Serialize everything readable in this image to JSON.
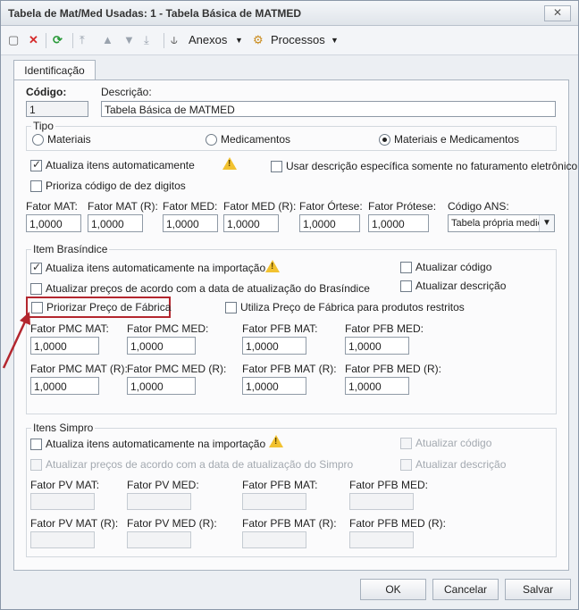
{
  "window": {
    "title": "Tabela de Mat/Med Usadas: 1 - Tabela Básica de MATMED",
    "close_label": "✕"
  },
  "toolbar": {
    "anexos": "Anexos",
    "processos": "Processos"
  },
  "tabs": {
    "identificacao": "Identificação"
  },
  "form": {
    "codigo_label": "Código:",
    "codigo_value": "1",
    "descricao_label": "Descrição:",
    "descricao_value": "Tabela Básica de MATMED",
    "tipo_label": "Tipo",
    "tipo_options": [
      "Materiais",
      "Medicamentos",
      "Materiais e Medicamentos"
    ],
    "tipo_selected": "Materiais e Medicamentos",
    "atualiza_itens": "Atualiza itens automaticamente",
    "usar_descricao": "Usar descrição específica somente no faturamento eletrônico",
    "prioriza_codigo": "Prioriza código de dez digitos",
    "fatores": [
      {
        "label": "Fator MAT:",
        "value": "1,0000"
      },
      {
        "label": "Fator MAT (R):",
        "value": "1,0000"
      },
      {
        "label": "Fator MED:",
        "value": "1,0000"
      },
      {
        "label": "Fator MED (R):",
        "value": "1,0000"
      },
      {
        "label": "Fator Órtese:",
        "value": "1,0000"
      },
      {
        "label": "Fator Prótese:",
        "value": "1,0000"
      }
    ],
    "codigo_ans_label": "Código ANS:",
    "codigo_ans_value": "Tabela própria medic"
  },
  "brasindice": {
    "title": "Item Brasíndice",
    "atualiza_importacao": "Atualiza itens automaticamente na importação",
    "atualizar_precos": "Atualizar preços de acordo com a data de atualização do Brasíndice",
    "priorizar_fabrica": "Priorizar Preço de Fábrica",
    "atualizar_codigo": "Atualizar código",
    "atualizar_descricao": "Atualizar descrição",
    "utiliza_fabrica": "Utiliza Preço de Fábrica para produtos restritos",
    "fatores_row1": [
      {
        "label": "Fator PMC MAT:",
        "value": "1,0000"
      },
      {
        "label": "Fator PMC MED:",
        "value": "1,0000"
      },
      {
        "label": "Fator PFB MAT:",
        "value": "1,0000"
      },
      {
        "label": "Fator PFB MED:",
        "value": "1,0000"
      }
    ],
    "fatores_row2": [
      {
        "label": "Fator PMC MAT (R):",
        "value": "1,0000"
      },
      {
        "label": "Fator PMC MED (R):",
        "value": "1,0000"
      },
      {
        "label": "Fator PFB MAT (R):",
        "value": "1,0000"
      },
      {
        "label": "Fator PFB MED (R):",
        "value": "1,0000"
      }
    ]
  },
  "simpro": {
    "title": "Itens Simpro",
    "atualiza_importacao": "Atualiza itens automaticamente na importação",
    "atualizar_precos": "Atualizar preços de acordo com a data de atualização do Simpro",
    "atualizar_codigo": "Atualizar código",
    "atualizar_descricao": "Atualizar descrição",
    "fatores_row1": [
      "Fator PV MAT:",
      "Fator PV MED:",
      "Fator PFB MAT:",
      "Fator PFB MED:"
    ],
    "fatores_row2": [
      "Fator PV MAT (R):",
      "Fator PV MED (R):",
      "Fator PFB MAT (R):",
      "Fator PFB MED (R):"
    ]
  },
  "buttons": {
    "ok": "OK",
    "cancelar": "Cancelar",
    "salvar": "Salvar"
  },
  "colors": {
    "highlight": "#b3262e",
    "warning": "#f2c230"
  }
}
